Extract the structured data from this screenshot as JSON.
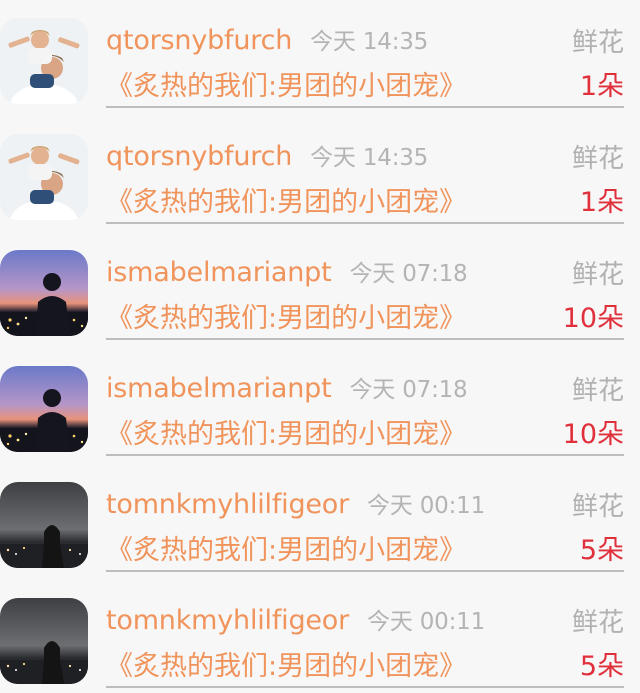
{
  "rows": [
    {
      "user": "qtorsnybfurch",
      "time": "今天 14:35",
      "gift_type": "鲜花",
      "book": "《炙热的我们:男团的小团宠》",
      "count": "1朵",
      "avatar": "father-child-avatar"
    },
    {
      "user": "qtorsnybfurch",
      "time": "今天 14:35",
      "gift_type": "鲜花",
      "book": "《炙热的我们:男团的小团宠》",
      "count": "1朵",
      "avatar": "father-child-avatar"
    },
    {
      "user": "ismabelmarianpt",
      "time": "今天 07:18",
      "gift_type": "鲜花",
      "book": "《炙热的我们:男团的小团宠》",
      "count": "10朵",
      "avatar": "sunset-silhouette-avatar"
    },
    {
      "user": "ismabelmarianpt",
      "time": "今天 07:18",
      "gift_type": "鲜花",
      "book": "《炙热的我们:男团的小团宠》",
      "count": "10朵",
      "avatar": "sunset-silhouette-avatar"
    },
    {
      "user": "tomnkmyhlilfigeor",
      "time": "今天 00:11",
      "gift_type": "鲜花",
      "book": "《炙热的我们:男团的小团宠》",
      "count": "5朵",
      "avatar": "night-city-avatar"
    },
    {
      "user": "tomnkmyhlilfigeor",
      "time": "今天 00:11",
      "gift_type": "鲜花",
      "book": "《炙热的我们:男团的小团宠》",
      "count": "5朵",
      "avatar": "night-city-avatar"
    }
  ]
}
